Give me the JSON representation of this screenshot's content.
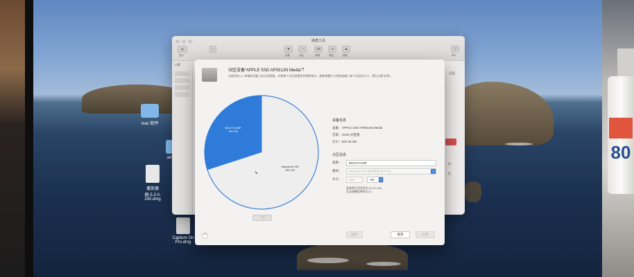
{
  "desktop": {
    "icons": [
      {
        "label": "mac 软件"
      },
      {
        "label": "ad"
      },
      {
        "label": "播放器"
      },
      {
        "label": "器-5.3.0-240.dmg"
      },
      {
        "label": "Capture On"
      },
      {
        "label": "Pro.dmg"
      }
    ]
  },
  "disk_utility": {
    "title": "磁盘工具",
    "sidebar_header": "内置",
    "toolbar": {
      "view_label": "显示",
      "sidebar_btn": "+",
      "actions": [
        {
          "icon": "first-aid-icon",
          "label": "急救"
        },
        {
          "icon": "partition-icon",
          "label": "分区"
        },
        {
          "icon": "erase-icon",
          "label": "抹掉"
        },
        {
          "icon": "restore-icon",
          "label": "恢复"
        },
        {
          "icon": "mount-icon",
          "label": "装载"
        }
      ],
      "info_label": "简介"
    },
    "right_values": [
      "GB",
      "GB",
      "图",
      "图"
    ]
  },
  "sheet": {
    "title": "分区设备“APPLE SSD AP0512N Media”？",
    "description": "点按添加 (+) 来增加设备上的分区数量。点按每个分区来更改名称和格式。拖移调整大小控制或输入每个分区的大小，然后点按“应用”。",
    "pie": {
      "slices": [
        {
          "name": "BOOTCAMP",
          "size": "150 GB",
          "value": 150,
          "color": "#2f7bd9"
        },
        {
          "name": "Macintosh HD",
          "size": "350 GB",
          "value": 350,
          "color": "#eeeeee"
        }
      ]
    },
    "pie_controls": "−  +",
    "device_info": {
      "title": "设备信息",
      "device": "设备：APPLE SSD AP0512N Media",
      "scheme": "方案：GUID 分区图",
      "size": "大小：500.28 GB"
    },
    "partition_info": {
      "title": "分区信息",
      "name_label": "名称：",
      "name_value": "BOOTCAMP",
      "format_label": "格式：",
      "format_value": "Windows NT 文件系统 (NTFS)",
      "size_label": "大小：",
      "size_value": "150",
      "size_unit": "GB",
      "size_note_1": "此卷将已用空间为 52.37 GB。",
      "size_note_2": "无法调整此卷的大小。"
    },
    "buttons": {
      "help": "?",
      "restore": "复原",
      "cancel": "取消",
      "apply": "应用"
    }
  }
}
